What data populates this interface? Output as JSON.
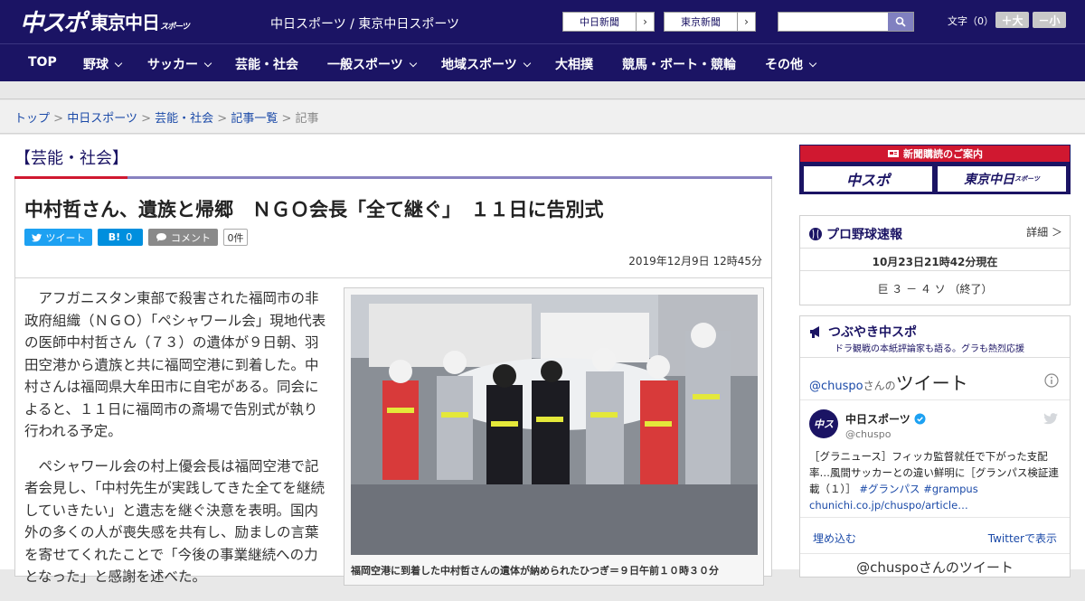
{
  "header": {
    "logo_main": "中スポ",
    "logo_sub": "東京中日",
    "logo_sub_small": "スポーツ",
    "site_name": "中日スポーツ / 東京中日スポーツ",
    "ext_links": [
      {
        "label": "中日新聞",
        "arrow": "›"
      },
      {
        "label": "東京新聞",
        "arrow": "›"
      }
    ],
    "search_placeholder": "",
    "font_size_label": "文字（0）",
    "font_plus": "＋大",
    "font_minus": "－小"
  },
  "nav": {
    "items": [
      {
        "label": "TOP"
      },
      {
        "label": "野球"
      },
      {
        "label": "サッカー"
      },
      {
        "label": "芸能・社会"
      },
      {
        "label": "一般スポーツ"
      },
      {
        "label": "地域スポーツ"
      },
      {
        "label": "大相撲"
      },
      {
        "label": "競馬・ボート・競輪"
      },
      {
        "label": "その他"
      }
    ]
  },
  "breadcrumb": {
    "items": [
      "トップ",
      "中日スポーツ",
      "芸能・社会",
      "記事一覧"
    ],
    "separator": ">",
    "current": "記事"
  },
  "article": {
    "category": "【芸能・社会】",
    "headline": "中村哲さん、遺族と帰郷　ＮＧＯ会長「全て継ぐ」　１１日に告別式",
    "tweet_label": "ツイート",
    "hatena_label": "B!",
    "hatena_count": "0",
    "comment_label": "コメント",
    "comment_count": "0件",
    "date": "2019年12月9日 12時45分",
    "paragraphs": [
      "アフガニスタン東部で殺害された福岡市の非政府組織（ＮＧＯ）「ペシャワール会」現地代表の医師中村哲さん（７３）の遺体が９日朝、羽田空港から遺族と共に福岡空港に到着した。中村さんは福岡県大牟田市に自宅がある。同会によると、１１日に福岡市の斎場で告別式が執り行われる予定。",
      "ペシャワール会の村上優会長は福岡空港で記者会見し、「中村先生が実践してきた全てを継続していきたい」と遺志を継ぐ決意を表明。国内外の多くの人が喪失感を共有し、励ましの言葉を寄せてくれたことで「今後の事業継続への力となった」と感謝を述べた。"
    ],
    "photo_caption": "福岡空港に到着した中村哲さんの遺体が納められたひつぎ＝９日午前１０時３０分"
  },
  "sidebar": {
    "ad_banner": "新聞購読のご案内",
    "ad_logo_1": "中スポ",
    "ad_logo_2": "東京中日",
    "ad_logo_2_small": "スポーツ",
    "baseball": {
      "title": "プロ野球速報",
      "detail_link": "詳細 ＞",
      "as_of": "10月23日21時42分現在",
      "score": "巨 ３ － ４ ソ （終了）"
    },
    "tweets": {
      "title": "つぶやき中スポ",
      "subtitle": "ドラ観戦の本紙評論家も語る。グラも熱烈応援",
      "handle_prefix": "@chuspo",
      "handle_suffix": "さんの",
      "tweet_word": "ツイート",
      "account_name": "中日スポーツ",
      "account_handle": "@chuspo",
      "tweet_text": "［グラニュース］フィッカ監督就任で下がった支配率…風間サッカーとの違い鮮明に［グランパス検証連載（１）］",
      "tweet_tags": "#グランパス #grampus",
      "tweet_link": "chunichi.co.jp/chuspo/article…",
      "embed_label": "埋め込む",
      "view_on_twitter": "Twitterで表示",
      "footer": "@chuspoさんのツイート"
    }
  },
  "colors": {
    "brand_navy": "#1b1464",
    "accent_red": "#d01830",
    "link_blue": "#1b4aa8"
  }
}
